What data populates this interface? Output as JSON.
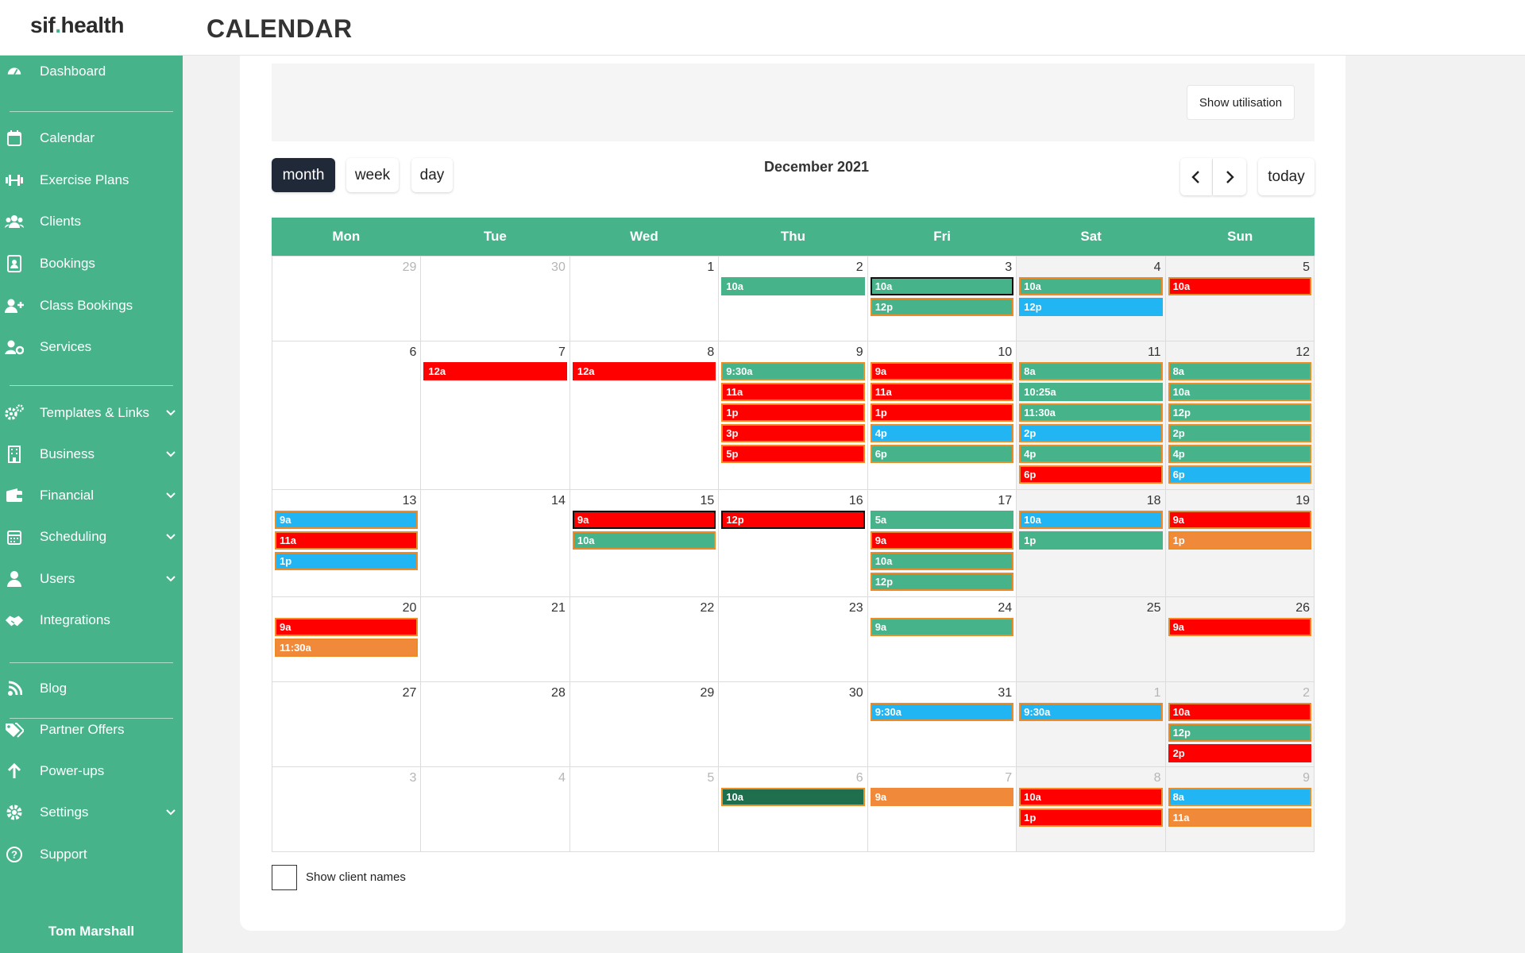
{
  "app": {
    "logo_text_a": "sif",
    "logo_dot": ".",
    "logo_text_b": "health",
    "page_title": "CALENDAR"
  },
  "sidebar": {
    "items": [
      {
        "label": "Dashboard",
        "icon": "dashboard-icon",
        "has_chevron": false
      },
      {
        "label": "Calendar",
        "icon": "calendar-icon",
        "has_chevron": false
      },
      {
        "label": "Exercise Plans",
        "icon": "dumbbell-icon",
        "has_chevron": false
      },
      {
        "label": "Clients",
        "icon": "clients-icon",
        "has_chevron": false
      },
      {
        "label": "Bookings",
        "icon": "bookings-icon",
        "has_chevron": false
      },
      {
        "label": "Class Bookings",
        "icon": "user-plus-icon",
        "has_chevron": false
      },
      {
        "label": "Services",
        "icon": "user-cog-icon",
        "has_chevron": false
      },
      {
        "label": "Templates & Links",
        "icon": "cogs-icon",
        "has_chevron": true
      },
      {
        "label": "Business",
        "icon": "building-icon",
        "has_chevron": true
      },
      {
        "label": "Financial",
        "icon": "wallet-icon",
        "has_chevron": true
      },
      {
        "label": "Scheduling",
        "icon": "schedule-icon",
        "has_chevron": true
      },
      {
        "label": "Users",
        "icon": "users-icon",
        "has_chevron": true
      },
      {
        "label": "Integrations",
        "icon": "handshake-icon",
        "has_chevron": false
      },
      {
        "label": "Blog",
        "icon": "blog-icon",
        "has_chevron": false
      },
      {
        "label": "Partner Offers",
        "icon": "tags-icon",
        "has_chevron": false
      },
      {
        "label": "Power-ups",
        "icon": "arrow-up-icon",
        "has_chevron": false
      },
      {
        "label": "Settings",
        "icon": "gear-icon",
        "has_chevron": true
      },
      {
        "label": "Support",
        "icon": "help-icon",
        "has_chevron": false
      }
    ],
    "user_name": "Tom Marshall"
  },
  "toolbar": {
    "show_utilisation": "Show utilisation",
    "views": [
      "month",
      "week",
      "day"
    ],
    "active_view": "month",
    "title": "December 2021",
    "today_label": "today"
  },
  "colors": {
    "brand": "#47b38b",
    "green": "#47b38b",
    "red": "#ff0000",
    "blue": "#22b5f3",
    "orange": "#f08a3a",
    "darkgreen": "#1f6e4d",
    "orange_border": "#f08a24",
    "black_border": "#111111"
  },
  "calendar": {
    "weekdays": [
      "Mon",
      "Tue",
      "Wed",
      "Thu",
      "Fri",
      "Sat",
      "Sun"
    ],
    "weeks": [
      [
        {
          "day": "29",
          "other": true,
          "events": []
        },
        {
          "day": "30",
          "other": true,
          "events": []
        },
        {
          "day": "1",
          "events": []
        },
        {
          "day": "2",
          "events": [
            {
              "t": "10a",
              "c": "green",
              "b": "n"
            }
          ]
        },
        {
          "day": "3",
          "events": [
            {
              "t": "10a",
              "c": "green",
              "b": "k"
            },
            {
              "t": "12p",
              "c": "green",
              "b": "o"
            }
          ]
        },
        {
          "day": "4",
          "events": [
            {
              "t": "10a",
              "c": "green",
              "b": "o"
            },
            {
              "t": "12p",
              "c": "blue",
              "b": "n"
            }
          ]
        },
        {
          "day": "5",
          "events": [
            {
              "t": "10a",
              "c": "red",
              "b": "o"
            }
          ]
        }
      ],
      [
        {
          "day": "6",
          "events": []
        },
        {
          "day": "7",
          "events": [
            {
              "t": "12a",
              "c": "red",
              "b": "n"
            }
          ]
        },
        {
          "day": "8",
          "events": [
            {
              "t": "12a",
              "c": "red",
              "b": "n"
            }
          ]
        },
        {
          "day": "9",
          "events": [
            {
              "t": "9:30a",
              "c": "green",
              "b": "o"
            },
            {
              "t": "11a",
              "c": "red",
              "b": "o"
            },
            {
              "t": "1p",
              "c": "red",
              "b": "o"
            },
            {
              "t": "3p",
              "c": "red",
              "b": "o"
            },
            {
              "t": "5p",
              "c": "red",
              "b": "o"
            }
          ]
        },
        {
          "day": "10",
          "events": [
            {
              "t": "9a",
              "c": "red",
              "b": "o"
            },
            {
              "t": "11a",
              "c": "red",
              "b": "o"
            },
            {
              "t": "1p",
              "c": "red",
              "b": "o"
            },
            {
              "t": "4p",
              "c": "blue",
              "b": "o"
            },
            {
              "t": "6p",
              "c": "green",
              "b": "o"
            }
          ]
        },
        {
          "day": "11",
          "events": [
            {
              "t": "8a",
              "c": "green",
              "b": "o"
            },
            {
              "t": "10:25a",
              "c": "green",
              "b": "n"
            },
            {
              "t": "11:30a",
              "c": "green",
              "b": "o"
            },
            {
              "t": "2p",
              "c": "blue",
              "b": "o"
            },
            {
              "t": "4p",
              "c": "green",
              "b": "o"
            },
            {
              "t": "6p",
              "c": "red",
              "b": "o"
            }
          ]
        },
        {
          "day": "12",
          "events": [
            {
              "t": "8a",
              "c": "green",
              "b": "o"
            },
            {
              "t": "10a",
              "c": "green",
              "b": "o"
            },
            {
              "t": "12p",
              "c": "green",
              "b": "o"
            },
            {
              "t": "2p",
              "c": "green",
              "b": "o"
            },
            {
              "t": "4p",
              "c": "green",
              "b": "o"
            },
            {
              "t": "6p",
              "c": "blue",
              "b": "o"
            }
          ]
        }
      ],
      [
        {
          "day": "13",
          "events": [
            {
              "t": "9a",
              "c": "blue",
              "b": "o"
            },
            {
              "t": "11a",
              "c": "red",
              "b": "o"
            },
            {
              "t": "1p",
              "c": "blue",
              "b": "o"
            }
          ]
        },
        {
          "day": "14",
          "events": []
        },
        {
          "day": "15",
          "events": [
            {
              "t": "9a",
              "c": "red",
              "b": "k"
            },
            {
              "t": "10a",
              "c": "green",
              "b": "o"
            }
          ]
        },
        {
          "day": "16",
          "events": [
            {
              "t": "12p",
              "c": "red",
              "b": "k"
            }
          ]
        },
        {
          "day": "17",
          "events": [
            {
              "t": "5a",
              "c": "green",
              "b": "n"
            },
            {
              "t": "9a",
              "c": "red",
              "b": "o"
            },
            {
              "t": "10a",
              "c": "green",
              "b": "o"
            },
            {
              "t": "12p",
              "c": "green",
              "b": "o"
            }
          ]
        },
        {
          "day": "18",
          "events": [
            {
              "t": "10a",
              "c": "blue",
              "b": "o"
            },
            {
              "t": "1p",
              "c": "green",
              "b": "n"
            }
          ]
        },
        {
          "day": "19",
          "events": [
            {
              "t": "9a",
              "c": "red",
              "b": "o"
            },
            {
              "t": "1p",
              "c": "orange",
              "b": "o"
            }
          ]
        }
      ],
      [
        {
          "day": "20",
          "events": [
            {
              "t": "9a",
              "c": "red",
              "b": "o"
            },
            {
              "t": "11:30a",
              "c": "orange",
              "b": "o"
            }
          ]
        },
        {
          "day": "21",
          "events": []
        },
        {
          "day": "22",
          "events": []
        },
        {
          "day": "23",
          "events": []
        },
        {
          "day": "24",
          "events": [
            {
              "t": "9a",
              "c": "green",
              "b": "o"
            }
          ]
        },
        {
          "day": "25",
          "events": []
        },
        {
          "day": "26",
          "events": [
            {
              "t": "9a",
              "c": "red",
              "b": "o"
            }
          ]
        }
      ],
      [
        {
          "day": "27",
          "events": []
        },
        {
          "day": "28",
          "events": []
        },
        {
          "day": "29",
          "events": []
        },
        {
          "day": "30",
          "events": []
        },
        {
          "day": "31",
          "events": [
            {
              "t": "9:30a",
              "c": "blue",
              "b": "o"
            }
          ]
        },
        {
          "day": "1",
          "other": true,
          "events": [
            {
              "t": "9:30a",
              "c": "blue",
              "b": "o"
            }
          ]
        },
        {
          "day": "2",
          "other": true,
          "events": [
            {
              "t": "10a",
              "c": "red",
              "b": "o"
            },
            {
              "t": "12p",
              "c": "green",
              "b": "o"
            },
            {
              "t": "2p",
              "c": "red",
              "b": "n"
            }
          ]
        }
      ],
      [
        {
          "day": "3",
          "other": true,
          "events": []
        },
        {
          "day": "4",
          "other": true,
          "events": []
        },
        {
          "day": "5",
          "other": true,
          "events": []
        },
        {
          "day": "6",
          "other": true,
          "events": [
            {
              "t": "10a",
              "c": "darkgreen",
              "b": "o"
            }
          ]
        },
        {
          "day": "7",
          "other": true,
          "events": [
            {
              "t": "9a",
              "c": "orange",
              "b": "n"
            }
          ]
        },
        {
          "day": "8",
          "other": true,
          "events": [
            {
              "t": "10a",
              "c": "red",
              "b": "o"
            },
            {
              "t": "1p",
              "c": "red",
              "b": "o"
            }
          ]
        },
        {
          "day": "9",
          "other": true,
          "events": [
            {
              "t": "8a",
              "c": "blue",
              "b": "o"
            },
            {
              "t": "11a",
              "c": "orange",
              "b": "o"
            }
          ]
        }
      ]
    ]
  },
  "footer": {
    "show_client_names": "Show client names"
  }
}
